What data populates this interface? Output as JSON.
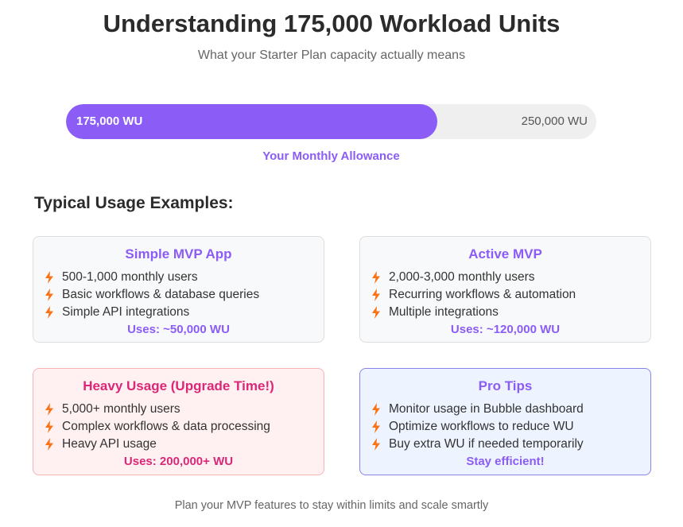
{
  "header": {
    "title": "Understanding 175,000 Workload Units",
    "subtitle": "What your Starter Plan capacity actually means"
  },
  "allowance": {
    "current_label": "175,000 WU",
    "max_label": "250,000 WU",
    "fill_fraction": 0.7,
    "caption": "Your Monthly Allowance"
  },
  "examples": {
    "heading": "Typical Usage Examples:",
    "cards": [
      {
        "title": "Simple MVP App",
        "items": [
          "500-1,000 monthly users",
          "Basic workflows & database queries",
          "Simple API integrations"
        ],
        "footer": "Uses: ~50,000 WU"
      },
      {
        "title": "Active MVP",
        "items": [
          "2,000-3,000 monthly users",
          "Recurring workflows & automation",
          "Multiple integrations"
        ],
        "footer": "Uses: ~120,000 WU"
      },
      {
        "title": "Heavy Usage (Upgrade Time!)",
        "items": [
          "5,000+ monthly users",
          "Complex workflows & data processing",
          "Heavy API usage"
        ],
        "footer": "Uses: 200,000+ WU"
      },
      {
        "title": "Pro Tips",
        "items": [
          "Monitor usage in Bubble dashboard",
          "Optimize workflows to reduce WU",
          "Buy extra WU if needed temporarily"
        ],
        "footer": "Stay efficient!"
      }
    ]
  },
  "footer_note": "Plan your MVP features to stay within limits and scale smartly",
  "colors": {
    "accent": "#8b5cf6",
    "warning": "#db2777",
    "bolt": "#f97316"
  },
  "icons": {
    "list_bullet": "lightning-bolt-icon"
  }
}
